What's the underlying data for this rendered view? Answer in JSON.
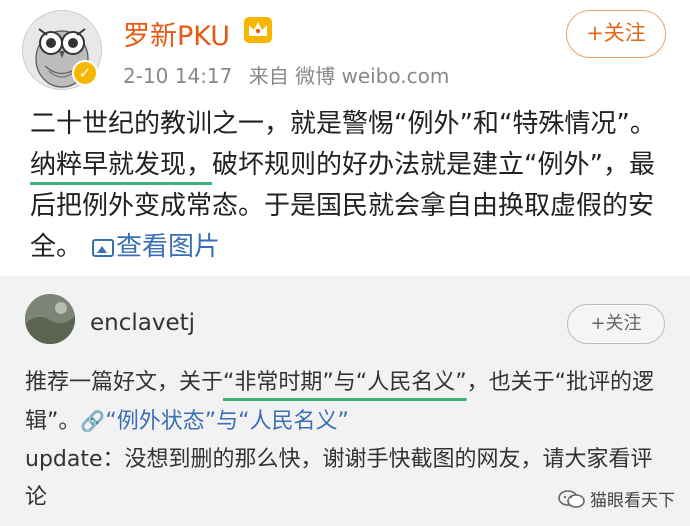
{
  "post": {
    "username": "罗新PKU",
    "time": "2-10 14:17",
    "source": "来自 微博 weibo.com",
    "follow_label": "+关注",
    "text_part1": "二十世纪的教训之一，就是警惕“例外”和“特殊情况”。",
    "text_underlined": "纳粹早就发现，",
    "text_part2": "破坏规则的好办法就是建立“例外”，最后把例外变成常态。于是国民就会拿自由换取虚假的安全。",
    "view_image_label": "查看图片"
  },
  "repost": {
    "username": "enclavetj",
    "follow_label": "+关注",
    "text_part1": "推荐一篇好文，关于",
    "text_underlined": "“非常时期”与“人民名义”",
    "text_part2": "，也关于“批评的逻辑”。",
    "link_text": "“例外状态”与“人民名义”",
    "text_part3": "update：没想到删的那么快，谢谢手快截图的网友，请大家看评论"
  },
  "watermark": {
    "text": "猫眼看天下"
  },
  "colors": {
    "username": "#e85a12",
    "link": "#3a6fb5",
    "underline": "#3bb57a"
  },
  "icons": [
    "owl-avatar",
    "verified-badge-icon",
    "crown-icon",
    "image-icon",
    "link-icon",
    "wechat-icon"
  ]
}
